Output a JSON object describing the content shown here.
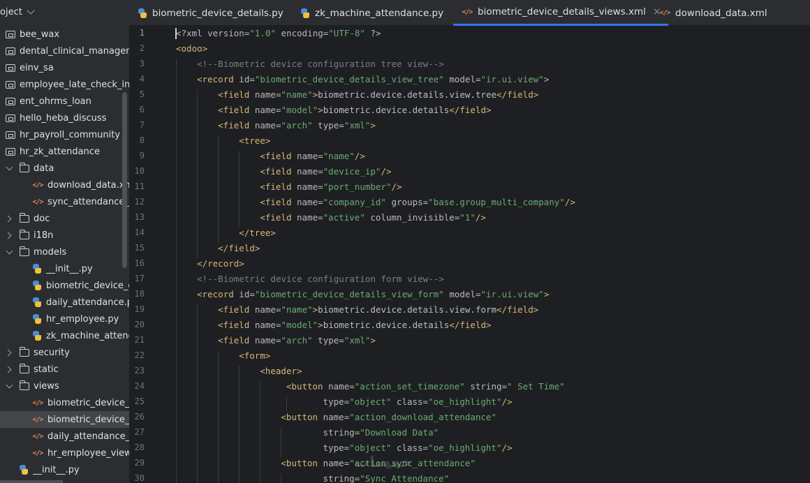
{
  "sidebar": {
    "header": "oject",
    "items": [
      {
        "label": "bee_wax",
        "icon": "module-icon",
        "arrow": "none",
        "indent": 8
      },
      {
        "label": "dental_clinical_management",
        "icon": "module-icon",
        "arrow": "none",
        "indent": 8
      },
      {
        "label": "einv_sa",
        "icon": "module-icon",
        "arrow": "none",
        "indent": 8
      },
      {
        "label": "employee_late_check_in",
        "icon": "module-icon",
        "arrow": "none",
        "indent": 8
      },
      {
        "label": "ent_ohrms_loan",
        "icon": "module-icon",
        "arrow": "none",
        "indent": 8
      },
      {
        "label": "hello_heba_discuss",
        "icon": "module-icon",
        "arrow": "none",
        "indent": 8
      },
      {
        "label": "hr_payroll_community",
        "icon": "module-icon",
        "arrow": "none",
        "indent": 8
      },
      {
        "label": "hr_zk_attendance",
        "icon": "module-icon",
        "arrow": "none",
        "indent": 8
      },
      {
        "label": "data",
        "icon": "folder-icon",
        "arrow": "down",
        "indent": 8
      },
      {
        "label": "download_data.xml",
        "icon": "xml-file-icon",
        "arrow": "none",
        "indent": 46
      },
      {
        "label": "sync_attendance_cron.xml",
        "icon": "xml-file-icon",
        "arrow": "none",
        "indent": 46
      },
      {
        "label": "doc",
        "icon": "folder-icon",
        "arrow": "right",
        "indent": 8
      },
      {
        "label": "i18n",
        "icon": "folder-icon",
        "arrow": "right",
        "indent": 8
      },
      {
        "label": "models",
        "icon": "folder-icon",
        "arrow": "down",
        "indent": 8
      },
      {
        "label": "__init__.py",
        "icon": "python-file-icon",
        "arrow": "none",
        "indent": 46
      },
      {
        "label": "biometric_device_details.py",
        "icon": "python-file-icon",
        "arrow": "none",
        "indent": 46
      },
      {
        "label": "daily_attendance.py",
        "icon": "python-file-icon",
        "arrow": "none",
        "indent": 46
      },
      {
        "label": "hr_employee.py",
        "icon": "python-file-icon",
        "arrow": "none",
        "indent": 46
      },
      {
        "label": "zk_machine_attendance.py",
        "icon": "python-file-icon",
        "arrow": "none",
        "indent": 46
      },
      {
        "label": "security",
        "icon": "folder-icon",
        "arrow": "right",
        "indent": 8
      },
      {
        "label": "static",
        "icon": "folder-icon",
        "arrow": "right",
        "indent": 8
      },
      {
        "label": "views",
        "icon": "folder-icon",
        "arrow": "down",
        "indent": 8
      },
      {
        "label": "biometric_device_attendance_views.xml",
        "icon": "xml-file-icon",
        "arrow": "none",
        "indent": 46
      },
      {
        "label": "biometric_device_details_views.xml",
        "icon": "xml-file-icon",
        "arrow": "none",
        "indent": 46,
        "selected": true
      },
      {
        "label": "daily_attendance_views.xml",
        "icon": "xml-file-icon",
        "arrow": "none",
        "indent": 46
      },
      {
        "label": "hr_employee_views.xml",
        "icon": "xml-file-icon",
        "arrow": "none",
        "indent": 46
      },
      {
        "label": "__init__.py",
        "icon": "python-file-icon",
        "arrow": "none",
        "indent": 27
      }
    ]
  },
  "tabs": [
    {
      "label": "biometric_device_details.py",
      "icon": "python-file-icon",
      "active": false
    },
    {
      "label": "zk_machine_attendance.py",
      "icon": "python-file-icon",
      "active": false
    },
    {
      "label": "biometric_device_details_views.xml",
      "icon": "xml-file-icon",
      "active": true,
      "close": "×"
    },
    {
      "label": "download_data.xml",
      "icon": "xml-file-icon",
      "active": false
    }
  ],
  "editor": {
    "current_line": 1,
    "lines": [
      {
        "n": "1",
        "indent": 0,
        "tokens": [
          [
            "pi",
            "<?xml "
          ],
          [
            "an",
            "version="
          ],
          [
            "av",
            "\"1.0\""
          ],
          [
            "an",
            " encoding="
          ],
          [
            "av",
            "\"UTF-8\""
          ],
          [
            "pi",
            " ?>"
          ]
        ]
      },
      {
        "n": "2",
        "indent": 0,
        "tokens": [
          [
            "t",
            "<odoo>"
          ]
        ]
      },
      {
        "n": "3",
        "indent": 1,
        "tokens": [
          [
            "cm",
            "<!--Biometric device configuration tree view-->"
          ]
        ]
      },
      {
        "n": "4",
        "indent": 1,
        "tokens": [
          [
            "t",
            "<record "
          ],
          [
            "an",
            "id="
          ],
          [
            "av",
            "\"biometric_device_details_view_tree\""
          ],
          [
            "an",
            " model="
          ],
          [
            "av",
            "\"ir.ui.view\""
          ],
          [
            "t",
            ">"
          ]
        ]
      },
      {
        "n": "5",
        "indent": 2,
        "tokens": [
          [
            "t",
            "<field "
          ],
          [
            "an",
            "name="
          ],
          [
            "av",
            "\"name\""
          ],
          [
            "t",
            ">"
          ],
          [
            "tx",
            "biometric.device.details.view.tree"
          ],
          [
            "t",
            "</field>"
          ]
        ]
      },
      {
        "n": "6",
        "indent": 2,
        "tokens": [
          [
            "t",
            "<field "
          ],
          [
            "an",
            "name="
          ],
          [
            "av",
            "\"model\""
          ],
          [
            "t",
            ">"
          ],
          [
            "tx",
            "biometric.device.details"
          ],
          [
            "t",
            "</field>"
          ]
        ]
      },
      {
        "n": "7",
        "indent": 2,
        "tokens": [
          [
            "t",
            "<field "
          ],
          [
            "an",
            "name="
          ],
          [
            "av",
            "\"arch\""
          ],
          [
            "an",
            " type="
          ],
          [
            "av",
            "\"xml\""
          ],
          [
            "t",
            ">"
          ]
        ]
      },
      {
        "n": "8",
        "indent": 3,
        "tokens": [
          [
            "t",
            "<tree>"
          ]
        ]
      },
      {
        "n": "9",
        "indent": 4,
        "tokens": [
          [
            "t",
            "<field "
          ],
          [
            "an",
            "name="
          ],
          [
            "av",
            "\"name\""
          ],
          [
            "t",
            "/>"
          ]
        ]
      },
      {
        "n": "10",
        "indent": 4,
        "tokens": [
          [
            "t",
            "<field "
          ],
          [
            "an",
            "name="
          ],
          [
            "av",
            "\"device_ip\""
          ],
          [
            "t",
            "/>"
          ]
        ]
      },
      {
        "n": "11",
        "indent": 4,
        "tokens": [
          [
            "t",
            "<field "
          ],
          [
            "an",
            "name="
          ],
          [
            "av",
            "\"port_number\""
          ],
          [
            "t",
            "/>"
          ]
        ]
      },
      {
        "n": "12",
        "indent": 4,
        "tokens": [
          [
            "t",
            "<field "
          ],
          [
            "an",
            "name="
          ],
          [
            "av",
            "\"company_id\""
          ],
          [
            "an",
            " groups="
          ],
          [
            "av",
            "\"base.group_multi_company\""
          ],
          [
            "t",
            "/>"
          ]
        ]
      },
      {
        "n": "13",
        "indent": 4,
        "tokens": [
          [
            "t",
            "<field "
          ],
          [
            "an",
            "name="
          ],
          [
            "av",
            "\"active\""
          ],
          [
            "an",
            " column_invisible="
          ],
          [
            "av",
            "\"1\""
          ],
          [
            "t",
            "/>"
          ]
        ]
      },
      {
        "n": "14",
        "indent": 3,
        "tokens": [
          [
            "t",
            "</tree>"
          ]
        ]
      },
      {
        "n": "15",
        "indent": 2,
        "tokens": [
          [
            "t",
            "</field>"
          ]
        ]
      },
      {
        "n": "16",
        "indent": 1,
        "tokens": [
          [
            "t",
            "</record>"
          ]
        ]
      },
      {
        "n": "17",
        "indent": 1,
        "tokens": [
          [
            "cm",
            "<!--Biometric device configuration form view-->"
          ]
        ]
      },
      {
        "n": "18",
        "indent": 1,
        "tokens": [
          [
            "t",
            "<record "
          ],
          [
            "an",
            "id="
          ],
          [
            "av",
            "\"biometric_device_details_view_form\""
          ],
          [
            "an",
            " model="
          ],
          [
            "av",
            "\"ir.ui.view\""
          ],
          [
            "t",
            ">"
          ]
        ]
      },
      {
        "n": "19",
        "indent": 2,
        "tokens": [
          [
            "t",
            "<field "
          ],
          [
            "an",
            "name="
          ],
          [
            "av",
            "\"name\""
          ],
          [
            "t",
            ">"
          ],
          [
            "tx",
            "biometric.device.details.view.form"
          ],
          [
            "t",
            "</field>"
          ]
        ]
      },
      {
        "n": "20",
        "indent": 2,
        "tokens": [
          [
            "t",
            "<field "
          ],
          [
            "an",
            "name="
          ],
          [
            "av",
            "\"model\""
          ],
          [
            "t",
            ">"
          ],
          [
            "tx",
            "biometric.device.details"
          ],
          [
            "t",
            "</field>"
          ]
        ]
      },
      {
        "n": "21",
        "indent": 2,
        "tokens": [
          [
            "t",
            "<field "
          ],
          [
            "an",
            "name="
          ],
          [
            "av",
            "\"arch\""
          ],
          [
            "an",
            " type="
          ],
          [
            "av",
            "\"xml\""
          ],
          [
            "t",
            ">"
          ]
        ]
      },
      {
        "n": "22",
        "indent": 3,
        "tokens": [
          [
            "t",
            "<form>"
          ]
        ]
      },
      {
        "n": "23",
        "indent": 4,
        "tokens": [
          [
            "t",
            "<header>"
          ]
        ]
      },
      {
        "n": "24",
        "indent": 5.25,
        "tokens": [
          [
            "t",
            "<button "
          ],
          [
            "an",
            "name="
          ],
          [
            "av",
            "\"action_set_timezone\""
          ],
          [
            "an",
            " string="
          ],
          [
            "av",
            "\" Set Time\""
          ]
        ]
      },
      {
        "n": "25",
        "indent": 7,
        "tokens": [
          [
            "an",
            "type="
          ],
          [
            "av",
            "\"object\""
          ],
          [
            "an",
            " class="
          ],
          [
            "av",
            "\"oe_highlight\""
          ],
          [
            "t",
            "/>"
          ]
        ]
      },
      {
        "n": "26",
        "indent": 5,
        "tokens": [
          [
            "t",
            "<button "
          ],
          [
            "an",
            "name="
          ],
          [
            "av",
            "\"action_download_attendance\""
          ]
        ]
      },
      {
        "n": "27",
        "indent": 7,
        "tokens": [
          [
            "an",
            "string="
          ],
          [
            "av",
            "\"Download Data\""
          ]
        ]
      },
      {
        "n": "28",
        "indent": 7,
        "tokens": [
          [
            "an",
            "type="
          ],
          [
            "av",
            "\"object\""
          ],
          [
            "an",
            " class="
          ],
          [
            "av",
            "\"oe_highlight\""
          ],
          [
            "t",
            "/>"
          ]
        ]
      },
      {
        "n": "29",
        "indent": 5,
        "tokens": [
          [
            "t",
            "<button "
          ],
          [
            "an",
            "name="
          ],
          [
            "av",
            "\"action_sync_attendance\""
          ]
        ]
      },
      {
        "n": "30",
        "indent": 7,
        "tokens": [
          [
            "an",
            "string="
          ],
          [
            "av",
            "\"Sync Attendance\""
          ]
        ]
      }
    ]
  },
  "watermark": "خمسات"
}
